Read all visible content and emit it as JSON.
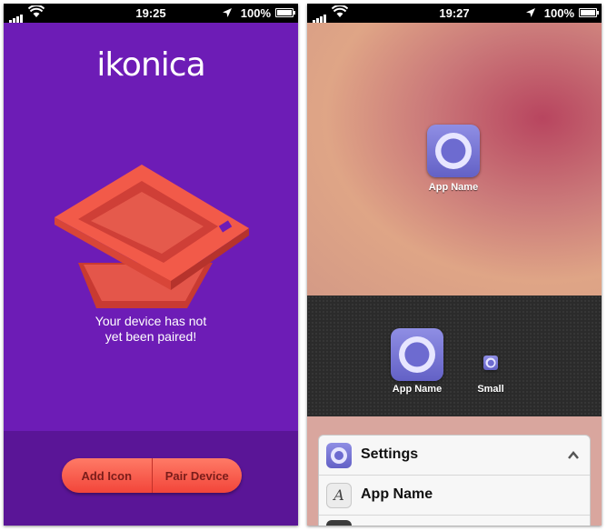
{
  "left": {
    "status": {
      "time": "19:25",
      "battery": "100%"
    },
    "logo": "ikonica",
    "message_line1": "Your device has not",
    "message_line2": "yet been paired!",
    "buttons": {
      "add_icon": "Add Icon",
      "pair_device": "Pair Device"
    }
  },
  "right": {
    "status": {
      "time": "19:27",
      "battery": "100%"
    },
    "top_icon_label": "App Name",
    "dock": {
      "large_label": "App Name",
      "small_label": "Small"
    },
    "settings": {
      "title": "Settings",
      "row_label": "App Name"
    }
  },
  "colors": {
    "purple": "#6d1cb6",
    "button": "#f2453a",
    "icon": "#6d6bd0"
  }
}
